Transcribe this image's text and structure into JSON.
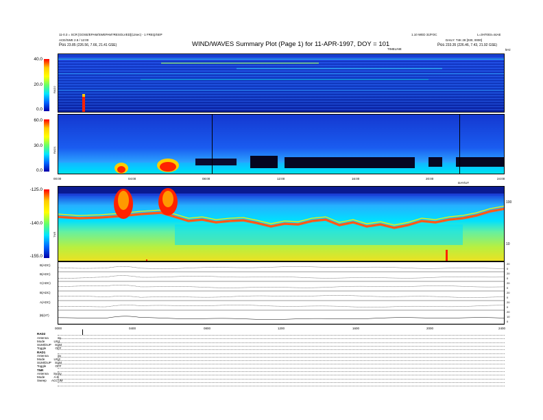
{
  "header": {
    "left_line1": "11-0.3 = SCR [GOSE/EPAM/SWEPAM?RESOLVED](12sec) - 1 FREQ/SEP",
    "left_line2": "ACE/SWE 2.8 / 12:00",
    "left_pos_label": "Pos",
    "left_pos_value": "23.85 (226.56, 7.66, 21.41 GSE)",
    "title": "WIND/WAVES Summary Plot (Page 1) for 11-APR-1997, DOY = 101",
    "right_line1": "1.10 WED 31/FOC",
    "right_line1b": "L=3H7003=44AE",
    "right_line2": "DAILY: T4K 28 [030, 0000]",
    "right_pos_label": "Pos",
    "right_pos_value": "233.35 (226.46, 7.43, 21.92 GSE)",
    "timeline_label": "TIMELINE",
    "corner_label": "kHz"
  },
  "chart_data": [
    {
      "type": "heatmap",
      "name_label": "RAD2",
      "y_ticks": [
        "40.0",
        "20.0",
        "0.0"
      ],
      "ylim": [
        0,
        40
      ],
      "colorbar_label": "RAD2"
    },
    {
      "type": "heatmap",
      "name_label": "RAD1",
      "y_ticks": [
        "60.0",
        "30.0",
        "0.0"
      ],
      "ylim": [
        0,
        60
      ],
      "colorbar_label": "RAD1",
      "x_ticks": [
        "00:00",
        "04:00",
        "08:00",
        "12:00",
        "16:00",
        "20:00",
        "24:00"
      ],
      "x_sub_label": "DAY/UT"
    },
    {
      "type": "heatmap",
      "name_label": "TNR",
      "y_ticks": [
        "-125.0",
        "-140.0",
        "-155.0"
      ],
      "ylim": [
        -155,
        -125
      ],
      "colorbar_label": "TNR",
      "right_ticks": [
        "100",
        "10"
      ],
      "log_scale_right": true
    },
    {
      "type": "line",
      "series": [
        {
          "name": "B(ADC)",
          "right_ticks": [
            "20",
            "0"
          ]
        },
        {
          "name": "B(ADC)",
          "right_ticks": [
            "20",
            "0"
          ]
        },
        {
          "name": "C(ADC)",
          "right_ticks": [
            "20",
            "0"
          ]
        },
        {
          "name": "B(ADC)",
          "right_ticks": [
            "20",
            "0"
          ]
        },
        {
          "name": "A(ADC)",
          "right_ticks": [
            "20",
            "0"
          ]
        },
        {
          "name": "|B|(nT)",
          "right_ticks": [
            "20",
            "10",
            "0"
          ]
        }
      ],
      "x_ticks": [
        "0000",
        "0400",
        "0800",
        "1200",
        "1600",
        "2000",
        "2400"
      ]
    }
  ],
  "status": {
    "rad2": {
      "title": "RAD2",
      "rows": [
        {
          "k": "Antenna",
          "v": "Sy"
        },
        {
          "k": "Mode",
          "v": "LIN1"
        },
        {
          "k": "SUM/DUP",
          "v": "SUM"
        },
        {
          "k": "Toggle",
          "v": "OFF"
        }
      ]
    },
    "rad1": {
      "title": "RAD1",
      "rows": [
        {
          "k": "Antenna",
          "v": "Sy"
        },
        {
          "k": "Mode",
          "v": "LIN2"
        },
        {
          "k": "SUM/DUP",
          "v": "SUM"
        },
        {
          "k": "Toggle",
          "v": "OFF"
        }
      ]
    },
    "tnr": {
      "title": "TNR",
      "rows": [
        {
          "k": "Antenna",
          "v": "Sy/Sy"
        },
        {
          "k": "Mode",
          "v": "A-B"
        },
        {
          "k": "Sweep",
          "v": "ACCUM"
        }
      ]
    }
  },
  "colors": {
    "bg": "#ffffff",
    "deep": "#0033cc",
    "cyan": "#00e5ff",
    "hot": "#ff2200"
  }
}
